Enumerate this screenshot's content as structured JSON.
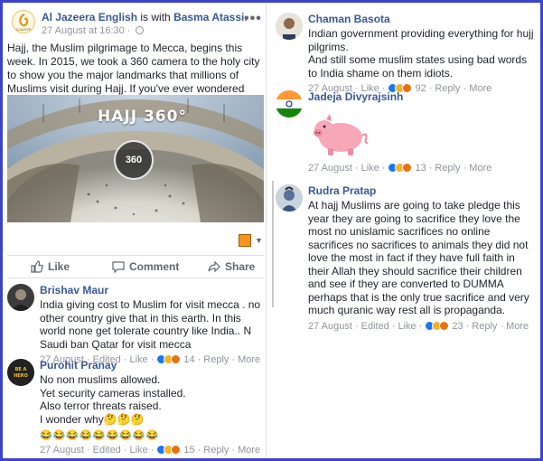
{
  "post": {
    "page_name": "Al Jazeera English",
    "is_with": "is with",
    "tagged": "Basma Atassi",
    "period": ".",
    "timestamp": "27 August at 16:30 ·",
    "text": "Hajj, the Muslim pilgrimage to Mecca, begins this week. In 2015, we took a 360 camera to the holy city to show you the major landmarks that millions of Muslims visit during Hajj. If you've ever wondered what it's all about, this video is for you.",
    "video_title": "HAJJ 360°",
    "video_badge": "360",
    "more_icon": "more-dots-icon"
  },
  "actions": {
    "like": "Like",
    "comment": "Comment",
    "share": "Share"
  },
  "comments_left": [
    {
      "name": "Brishav Maur",
      "text": "India giving cost to Muslim for visit mecca . no other country give that in this earth. In this world none get tolerate country like India.. N Saudi ban Qatar for visit mecca",
      "date": "27 August",
      "edited": "Edited",
      "like": "Like",
      "count": "14",
      "reply": "Reply",
      "more": "More"
    },
    {
      "name": "Purohit Pranay",
      "text_lines": [
        "No non muslims allowed.",
        "Yet security cameras installed.",
        "Also terror threats raised.",
        "I wonder why🤔🤔🤔"
      ],
      "emoji_row": "😂😂😂😂😂😂😂😂😂",
      "date": "27 August",
      "edited": "Edited",
      "like": "Like",
      "count": "15",
      "reply": "Reply",
      "more": "More"
    }
  ],
  "comments_right": [
    {
      "name": "Chaman Basota",
      "text_lines": [
        "Indian government providing everything for hujj pilgrims.",
        "And still some muslim states using bad words to India shame on them idiots."
      ],
      "date": "27 August",
      "like": "Like",
      "count": "92",
      "reply": "Reply",
      "more": "More"
    },
    {
      "name": "Jadeja Divyrajsinh",
      "sticker": "pig-sticker",
      "date": "27 August",
      "like": "Like",
      "count": "13",
      "reply": "Reply",
      "more": "More"
    },
    {
      "name": "Rudra Pratap",
      "text": "At hajj Muslims are going to take pledge this year they are going to sacrifice they love the most no unislamic sacrifices no online sacrifices no sacrifices to animals they did not love the most in fact if they have full faith in their Allah they should sacrifice their children and see if they are converted to DUMMA perhaps that is the only true sacrifice and very much quranic way rest all is propaganda.",
      "date": "27 August",
      "edited": "Edited",
      "like": "Like",
      "count": "23",
      "reply": "Reply",
      "more": "More"
    }
  ],
  "colors": {
    "frame": "#3a43c9",
    "name_blue": "#385898",
    "meta_gray": "#90949c"
  }
}
